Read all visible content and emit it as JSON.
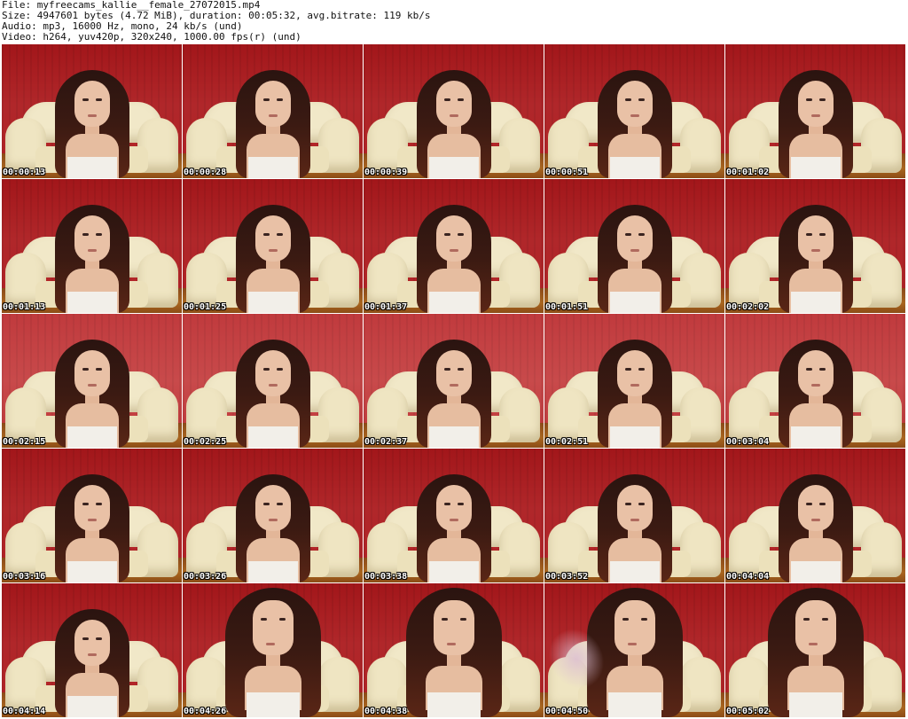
{
  "header": {
    "file_line": "File: myfreecams_kallie__female_27072015.mp4",
    "size_line": "Size: 4947601 bytes (4.72 MiB), duration: 00:05:32, avg.bitrate: 119 kb/s",
    "audio_line": "Audio: mp3, 16000 Hz, mono, 24 kb/s (und)",
    "video_line": "Video: h264, yuv420p, 320x240, 1000.00 fps(r) (und)"
  },
  "thumbnails": [
    {
      "timestamp": "00:00:13"
    },
    {
      "timestamp": "00:00:28"
    },
    {
      "timestamp": "00:00:39"
    },
    {
      "timestamp": "00:00:51"
    },
    {
      "timestamp": "00:01:02"
    },
    {
      "timestamp": "00:01:13"
    },
    {
      "timestamp": "00:01:25"
    },
    {
      "timestamp": "00:01:37"
    },
    {
      "timestamp": "00:01:51"
    },
    {
      "timestamp": "00:02:02"
    },
    {
      "timestamp": "00:02:15"
    },
    {
      "timestamp": "00:02:25"
    },
    {
      "timestamp": "00:02:37"
    },
    {
      "timestamp": "00:02:51"
    },
    {
      "timestamp": "00:03:04"
    },
    {
      "timestamp": "00:03:16"
    },
    {
      "timestamp": "00:03:26"
    },
    {
      "timestamp": "00:03:38"
    },
    {
      "timestamp": "00:03:52"
    },
    {
      "timestamp": "00:04:04"
    },
    {
      "timestamp": "00:04:14"
    },
    {
      "timestamp": "00:04:26"
    },
    {
      "timestamp": "00:04:38"
    },
    {
      "timestamp": "00:04:50"
    },
    {
      "timestamp": "00:05:02"
    }
  ]
}
